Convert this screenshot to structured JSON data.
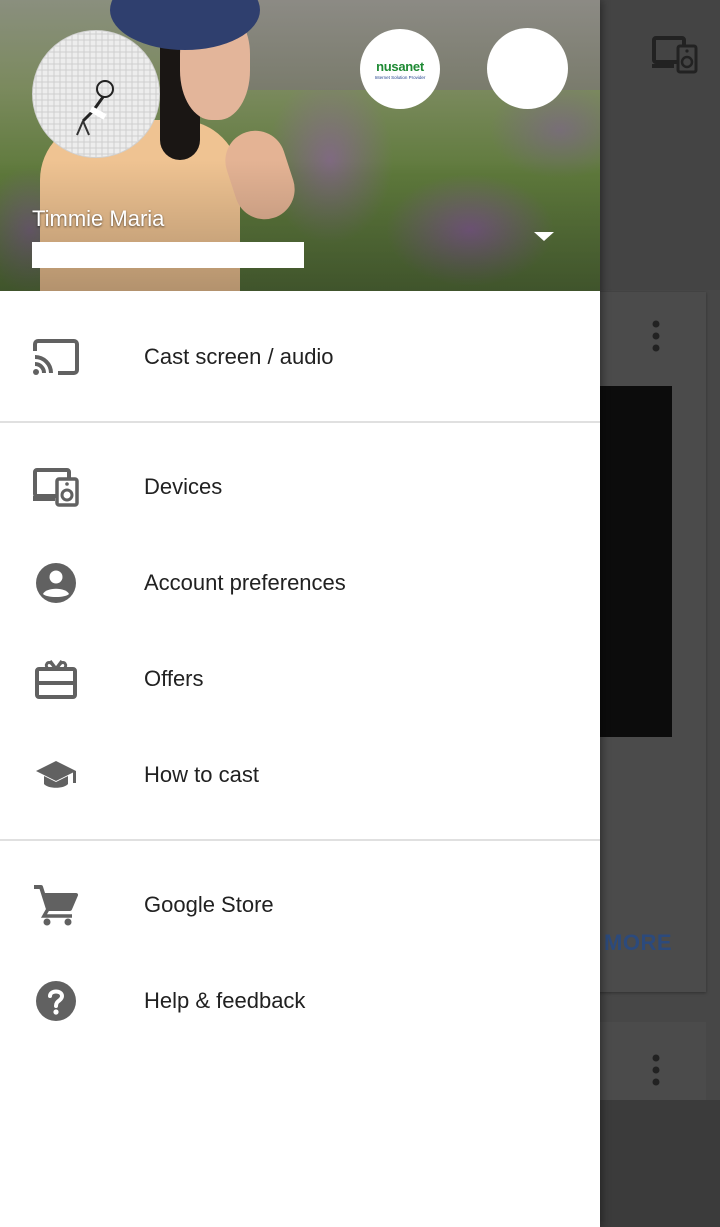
{
  "account": {
    "name": "Timmie Maria",
    "other_account_brand": "nusanet",
    "other_account_brand_sub": "Internet Solution Provider"
  },
  "menu": {
    "group1": [
      {
        "label": "Cast screen / audio",
        "icon": "cast-icon"
      }
    ],
    "group2": [
      {
        "label": "Devices",
        "icon": "devices-icon"
      },
      {
        "label": "Account preferences",
        "icon": "account-circle-icon"
      },
      {
        "label": "Offers",
        "icon": "gift-card-icon"
      },
      {
        "label": "How to cast",
        "icon": "school-icon"
      }
    ],
    "group3": [
      {
        "label": "Google Store",
        "icon": "shopping-cart-icon"
      },
      {
        "label": "Help & feedback",
        "icon": "help-icon"
      }
    ]
  },
  "background": {
    "card_action": "MORE"
  },
  "colors": {
    "drawer_bg": "#ffffff",
    "text": "#212121",
    "icon": "#616161",
    "scrim": "#474747",
    "link": "#2c4a7c"
  }
}
